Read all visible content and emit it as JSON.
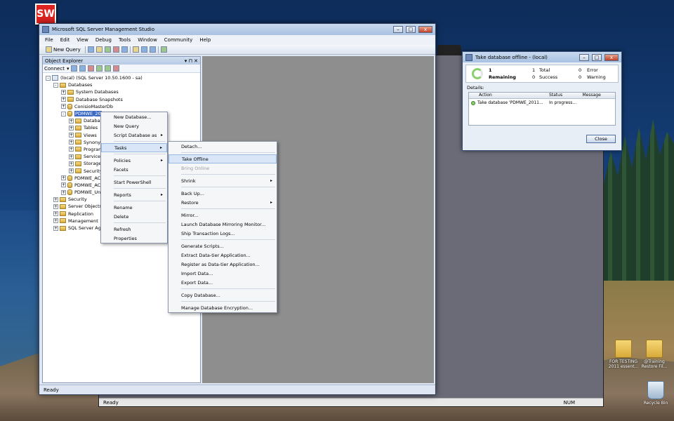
{
  "desktop": {
    "icons": [
      {
        "label": "FOR TESTING 2011 essent...",
        "icon": "folder-icon"
      },
      {
        "label": "@Training Restore Fil...",
        "icon": "folder-icon"
      },
      {
        "label": "Recycle Bin",
        "icon": "recycle-bin-icon"
      }
    ],
    "sw_label": "SW"
  },
  "back_window": {
    "status": "Ready",
    "num": "NUM"
  },
  "ssms": {
    "title": "Microsoft SQL Server Management Studio",
    "menu": [
      "File",
      "Edit",
      "View",
      "Debug",
      "Tools",
      "Window",
      "Community",
      "Help"
    ],
    "toolbar": {
      "new_query": "New Query"
    },
    "object_explorer": {
      "title": "Object Explorer",
      "connect": "Connect",
      "nodes": [
        {
          "label": "(local) (SQL Server 10.50.1600 - sa)",
          "kind": "server",
          "level": 0,
          "exp": "-"
        },
        {
          "label": "Databases",
          "kind": "folder",
          "level": 1,
          "exp": "-"
        },
        {
          "label": "System Databases",
          "kind": "folder",
          "level": 2,
          "exp": "+"
        },
        {
          "label": "Database Snapshots",
          "kind": "folder",
          "level": 2,
          "exp": "+"
        },
        {
          "label": "ConisioMasterDb",
          "kind": "db",
          "level": 2,
          "exp": "+"
        },
        {
          "label": "PDMWE_20",
          "kind": "db",
          "level": 2,
          "exp": "-",
          "selected": true
        },
        {
          "label": "Database",
          "kind": "folder",
          "level": 3,
          "exp": "+"
        },
        {
          "label": "Tables",
          "kind": "folder",
          "level": 3,
          "exp": "+"
        },
        {
          "label": "Views",
          "kind": "folder",
          "level": 3,
          "exp": "+"
        },
        {
          "label": "Synonym",
          "kind": "folder",
          "level": 3,
          "exp": "+"
        },
        {
          "label": "Program",
          "kind": "folder",
          "level": 3,
          "exp": "+"
        },
        {
          "label": "Service B",
          "kind": "folder",
          "level": 3,
          "exp": "+"
        },
        {
          "label": "Storage",
          "kind": "folder",
          "level": 3,
          "exp": "+"
        },
        {
          "label": "Security",
          "kind": "folder",
          "level": 3,
          "exp": "+"
        },
        {
          "label": "PDMWE_AC",
          "kind": "db",
          "level": 2,
          "exp": "+"
        },
        {
          "label": "PDMWE_AC",
          "kind": "db",
          "level": 2,
          "exp": "+"
        },
        {
          "label": "PDMWE_Un",
          "kind": "db",
          "level": 2,
          "exp": "+"
        },
        {
          "label": "Security",
          "kind": "folder",
          "level": 1,
          "exp": "+"
        },
        {
          "label": "Server Objects",
          "kind": "folder",
          "level": 1,
          "exp": "+"
        },
        {
          "label": "Replication",
          "kind": "folder",
          "level": 1,
          "exp": "+"
        },
        {
          "label": "Management",
          "kind": "folder",
          "level": 1,
          "exp": "+"
        },
        {
          "label": "SQL Server Agen",
          "kind": "folder",
          "level": 1,
          "exp": "+"
        }
      ],
      "status": "Ready"
    },
    "status": "Ready"
  },
  "context_menu": [
    {
      "label": "New Database..."
    },
    {
      "label": "New Query"
    },
    {
      "label": "Script Database as",
      "submenu": true
    },
    {
      "sep": true
    },
    {
      "label": "Tasks",
      "submenu": true,
      "hot": true
    },
    {
      "sep": true
    },
    {
      "label": "Policies",
      "submenu": true
    },
    {
      "label": "Facets"
    },
    {
      "sep": true
    },
    {
      "label": "Start PowerShell"
    },
    {
      "sep": true
    },
    {
      "label": "Reports",
      "submenu": true
    },
    {
      "sep": true
    },
    {
      "label": "Rename"
    },
    {
      "label": "Delete"
    },
    {
      "sep": true
    },
    {
      "label": "Refresh"
    },
    {
      "label": "Properties"
    }
  ],
  "tasks_menu": [
    {
      "label": "Detach..."
    },
    {
      "sep": true
    },
    {
      "label": "Take Offline",
      "hot": true
    },
    {
      "label": "Bring Online",
      "disabled": true
    },
    {
      "sep": true
    },
    {
      "label": "Shrink",
      "submenu": true
    },
    {
      "sep": true
    },
    {
      "label": "Back Up..."
    },
    {
      "label": "Restore",
      "submenu": true
    },
    {
      "sep": true
    },
    {
      "label": "Mirror..."
    },
    {
      "label": "Launch Database Mirroring Monitor..."
    },
    {
      "label": "Ship Transaction Logs..."
    },
    {
      "sep": true
    },
    {
      "label": "Generate Scripts..."
    },
    {
      "label": "Extract Data-tier Application..."
    },
    {
      "label": "Register as Data-tier Application..."
    },
    {
      "label": "Import Data..."
    },
    {
      "label": "Export Data..."
    },
    {
      "sep": true
    },
    {
      "label": "Copy Database..."
    },
    {
      "sep": true
    },
    {
      "label": "Manage Database Encryption..."
    }
  ],
  "dialog": {
    "title": "Take database offline - (local)",
    "count": "1",
    "state": "Remaining",
    "total_n": "1",
    "total_l": "Total",
    "success_n": "0",
    "success_l": "Success",
    "error_n": "0",
    "error_l": "Error",
    "warning_n": "0",
    "warning_l": "Warning",
    "details": "Details:",
    "cols": [
      "Action",
      "Status",
      "Message"
    ],
    "row": {
      "action": "Take database 'PDMWE_2011...",
      "status": "In progress..."
    },
    "close": "Close"
  }
}
